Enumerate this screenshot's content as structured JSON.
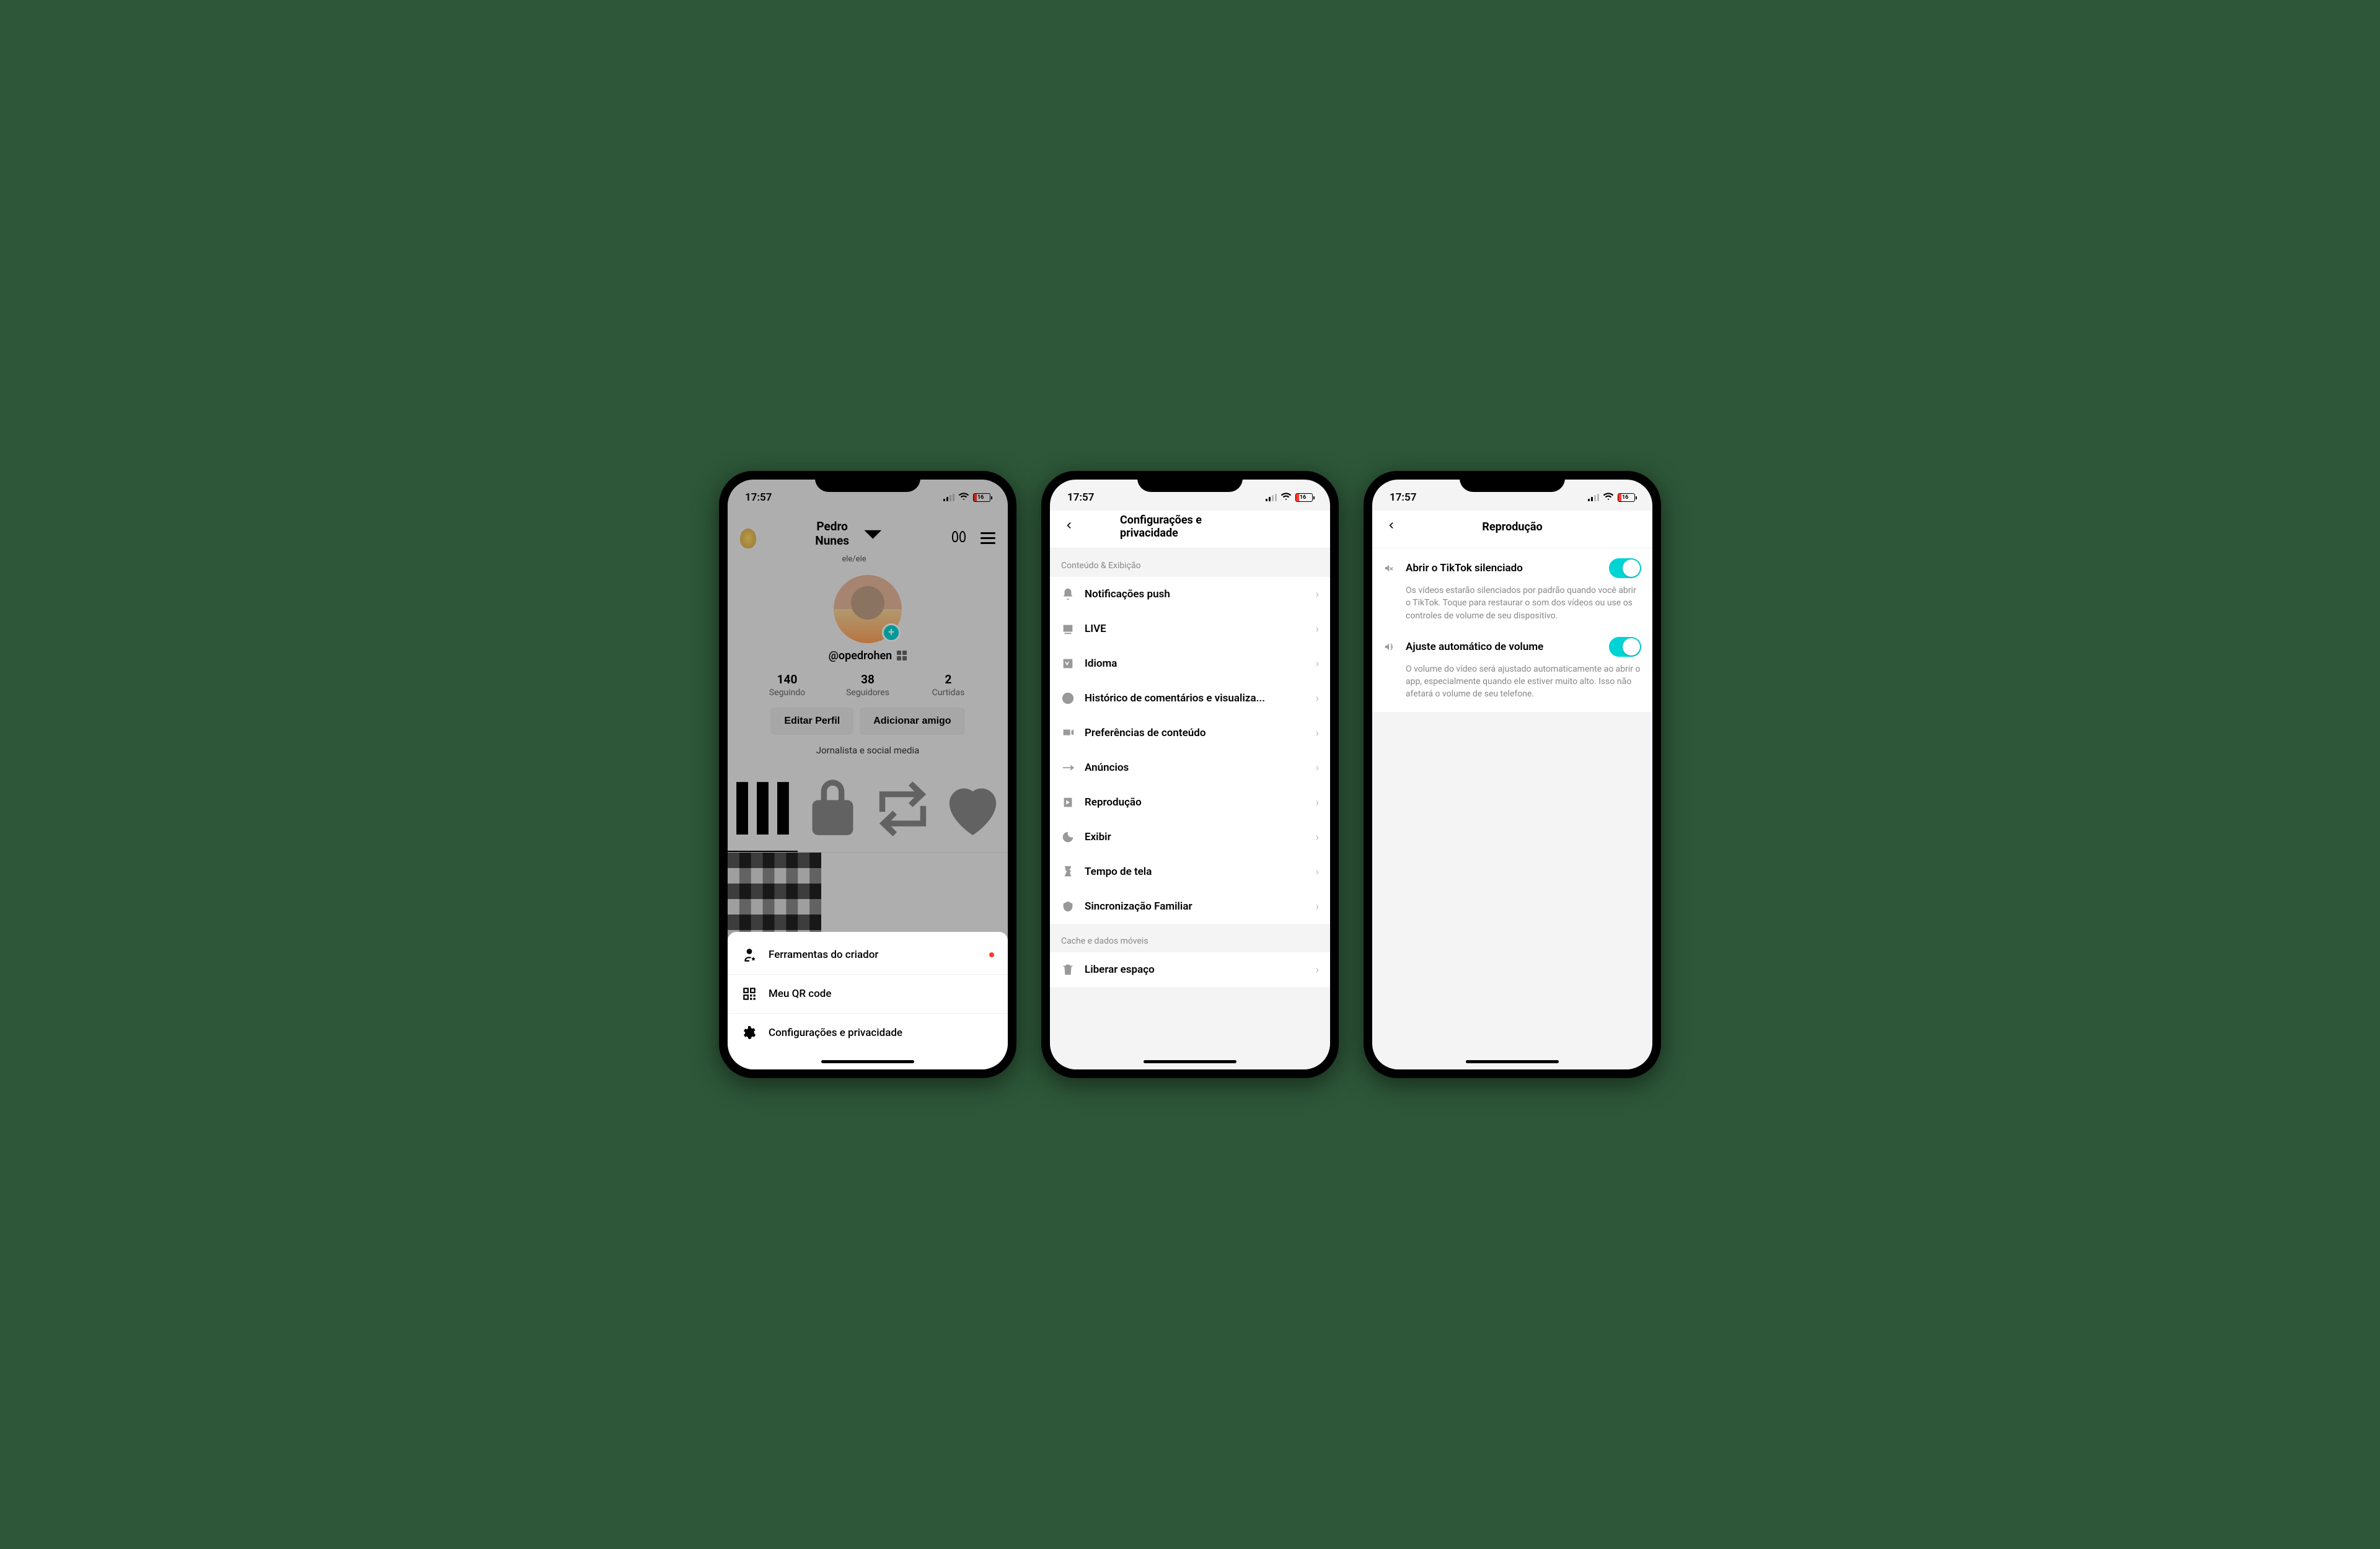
{
  "status": {
    "time": "17:57",
    "battery": "16"
  },
  "phone1": {
    "profile_name": "Pedro Nunes",
    "pronoun": "ele/ele",
    "username": "@opedrohen",
    "stats": [
      {
        "num": "140",
        "label": "Seguindo"
      },
      {
        "num": "38",
        "label": "Seguidores"
      },
      {
        "num": "2",
        "label": "Curtidas"
      }
    ],
    "edit_btn": "Editar Perfil",
    "add_friend_btn": "Adicionar amigo",
    "bio": "Jornalista e social media",
    "sheet": [
      {
        "label": "Ferramentas do criador",
        "dot": true
      },
      {
        "label": "Meu QR code",
        "dot": false
      },
      {
        "label": "Configurações e privacidade",
        "dot": false
      }
    ]
  },
  "phone2": {
    "title": "Configurações e privacidade",
    "section1": "Conteúdo & Exibição",
    "items1": [
      "Notificações push",
      "LIVE",
      "Idioma",
      "Histórico de comentários e visualiza...",
      "Preferências de conteúdo",
      "Anúncios",
      "Reprodução",
      "Exibir",
      "Tempo de tela",
      "Sincronização Familiar"
    ],
    "section2": "Cache e dados móveis",
    "items2": [
      "Liberar espaço"
    ]
  },
  "phone3": {
    "title": "Reprodução",
    "opt1_label": "Abrir o TikTok silenciado",
    "opt1_desc": "Os vídeos estarão silenciados por padrão quando você abrir o TikTok. Toque para restaurar o som dos vídeos ou use os controles de volume de seu dispositivo.",
    "opt2_label": "Ajuste automático de volume",
    "opt2_desc": "O volume do vídeo será ajustado automaticamente ao abrir o app, especialmente quando ele estiver muito alto. Isso não afetará o volume de seu telefone."
  }
}
